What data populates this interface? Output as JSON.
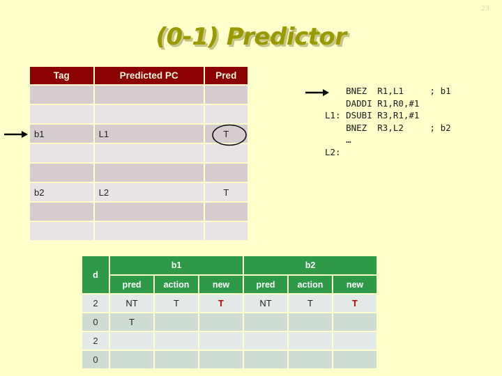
{
  "slide": {
    "page_number": "23",
    "title": "(0-1) Predictor",
    "background_color": "#ffffcc",
    "title_color": "#999900"
  },
  "btb": {
    "header_color": "#8b0000",
    "headers": [
      "Tag",
      "Predicted PC",
      "Pred"
    ],
    "rows": [
      {
        "tag": "",
        "pc": "",
        "pred": "",
        "shade": "dark"
      },
      {
        "tag": "",
        "pc": "",
        "pred": "",
        "shade": "light"
      },
      {
        "tag": "b1",
        "pc": "L1",
        "pred": "T",
        "shade": "dark"
      },
      {
        "tag": "",
        "pc": "",
        "pred": "",
        "shade": "light"
      },
      {
        "tag": "",
        "pc": "",
        "pred": "",
        "shade": "dark"
      },
      {
        "tag": "b2",
        "pc": "L2",
        "pred": "T",
        "shade": "light"
      },
      {
        "tag": "",
        "pc": "",
        "pred": "",
        "shade": "dark"
      },
      {
        "tag": "",
        "pc": "",
        "pred": "",
        "shade": "light"
      }
    ]
  },
  "code": {
    "lines": [
      "    BNEZ  R1,L1     ; b1",
      "    DADDI R1,R0,#1",
      "L1: DSUBI R3,R1,#1",
      "    BNEZ  R3,L2     ; b2",
      "    …",
      "L2:"
    ],
    "text": "    BNEZ  R1,L1     ; b1\n    DADDI R1,R0,#1\nL1: DSUBI R3,R1,#1\n    BNEZ  R3,L2     ; b2\n    …\nL2:"
  },
  "trace": {
    "header_color": "#2e9947",
    "d_header": "d",
    "group_headers": [
      "b1",
      "b2"
    ],
    "sub_headers": [
      "pred",
      "action",
      "new",
      "pred",
      "action",
      "new"
    ],
    "rows": [
      {
        "d": "2",
        "cells": [
          "NT",
          "T",
          "T",
          "NT",
          "T",
          "T"
        ],
        "shade": "light"
      },
      {
        "d": "0",
        "cells": [
          "T",
          "",
          "",
          "",
          "",
          ""
        ],
        "shade": "dark"
      },
      {
        "d": "2",
        "cells": [
          "",
          "",
          "",
          "",
          "",
          ""
        ],
        "shade": "light"
      },
      {
        "d": "0",
        "cells": [
          "",
          "",
          "",
          "",
          "",
          ""
        ],
        "shade": "dark"
      }
    ],
    "new_value_color": "#cc0000"
  },
  "annotations": {
    "btb_row_arrow": "right-arrow",
    "code_arrow": "right-arrow",
    "pred_ellipse": "hand-drawn-ellipse"
  }
}
